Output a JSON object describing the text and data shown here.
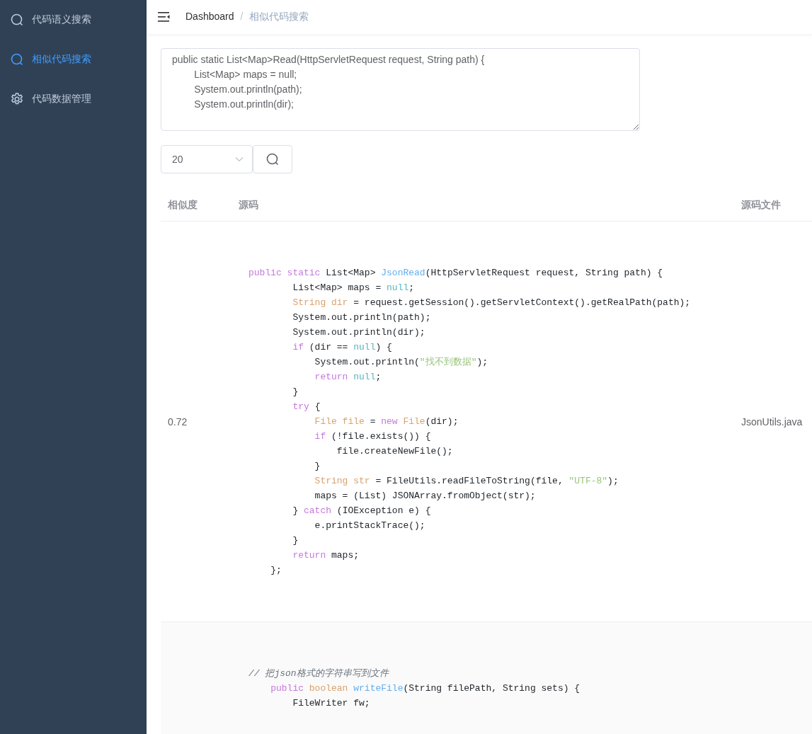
{
  "sidebar": {
    "items": [
      {
        "label": "代码语义搜索",
        "kind": "search",
        "selected": false
      },
      {
        "label": "相似代码搜索",
        "kind": "search",
        "selected": true
      },
      {
        "label": "代码数据管理",
        "kind": "settings",
        "selected": false
      }
    ]
  },
  "breadcrumb": [
    "Dashboard",
    "/",
    "相似代码搜索"
  ],
  "query": {
    "value": "public static List<Map>Read(HttpServletRequest request, String path) {\n\t\tList<Map> maps = null;\n\t\tSystem.out.println(path);\n\t\tSystem.out.println(dir);"
  },
  "count_select": {
    "value": "20"
  },
  "table": {
    "columns": [
      "相似度",
      "源码",
      "源码文件"
    ],
    "rows": [
      {
        "similarity": "0.72",
        "file": "JsonUtils.java",
        "code": [
          [
            {
              "kind": "keyword",
              "text": "public static"
            },
            {
              "kind": "plain",
              "text": " List<Map> "
            },
            {
              "kind": "function",
              "text": "JsonRead"
            },
            {
              "kind": "plain",
              "text": "(HttpServletRequest request, String path) {"
            }
          ],
          [
            {
              "kind": "plain",
              "text": "        List<Map> maps = "
            },
            {
              "kind": "literal",
              "text": "null"
            },
            {
              "kind": "plain",
              "text": ";"
            }
          ],
          [
            {
              "kind": "type",
              "text": "        String dir"
            },
            {
              "kind": "plain",
              "text": " = request.getSession().getServletContext().getRealPath(path);"
            }
          ],
          [
            {
              "kind": "plain",
              "text": "        System.out.println(path);"
            }
          ],
          [
            {
              "kind": "plain",
              "text": "        System.out.println(dir);"
            }
          ],
          [
            {
              "kind": "keyword",
              "text": "        if"
            },
            {
              "kind": "plain",
              "text": " (dir == "
            },
            {
              "kind": "literal",
              "text": "null"
            },
            {
              "kind": "plain",
              "text": ") {"
            }
          ],
          [
            {
              "kind": "plain",
              "text": "            System.out.println("
            },
            {
              "kind": "string",
              "text": "\"找不到数据\""
            },
            {
              "kind": "plain",
              "text": ");"
            }
          ],
          [
            {
              "kind": "keyword",
              "text": "            return"
            },
            {
              "kind": "literal",
              "text": " null"
            },
            {
              "kind": "plain",
              "text": ";"
            }
          ],
          [
            {
              "kind": "plain",
              "text": "        }"
            }
          ],
          [
            {
              "kind": "keyword",
              "text": "        try"
            },
            {
              "kind": "plain",
              "text": " {"
            }
          ],
          [
            {
              "kind": "type",
              "text": "            File file"
            },
            {
              "kind": "plain",
              "text": " = "
            },
            {
              "kind": "keyword",
              "text": "new"
            },
            {
              "kind": "type",
              "text": " File"
            },
            {
              "kind": "plain",
              "text": "(dir);"
            }
          ],
          [
            {
              "kind": "keyword",
              "text": "            if"
            },
            {
              "kind": "plain",
              "text": " (!file.exists()) {"
            }
          ],
          [
            {
              "kind": "plain",
              "text": "                file.createNewFile();"
            }
          ],
          [
            {
              "kind": "plain",
              "text": "            }"
            }
          ],
          [
            {
              "kind": "type",
              "text": "            String str"
            },
            {
              "kind": "plain",
              "text": " = FileUtils.readFileToString(file, "
            },
            {
              "kind": "string",
              "text": "\"UTF-8\""
            },
            {
              "kind": "plain",
              "text": ");"
            }
          ],
          [
            {
              "kind": "plain",
              "text": "            maps = (List) JSONArray.fromObject(str);"
            }
          ],
          [
            {
              "kind": "plain",
              "text": "        } "
            },
            {
              "kind": "keyword",
              "text": "catch"
            },
            {
              "kind": "plain",
              "text": " (IOException e) {"
            }
          ],
          [
            {
              "kind": "plain",
              "text": "            e.printStackTrace();"
            }
          ],
          [
            {
              "kind": "plain",
              "text": "        }"
            }
          ],
          [
            {
              "kind": "keyword",
              "text": "        return"
            },
            {
              "kind": "plain",
              "text": " maps;"
            }
          ],
          [
            {
              "kind": "plain",
              "text": "    };"
            }
          ]
        ]
      },
      {
        "code": [
          [
            {
              "kind": "comment",
              "text": "// 把json格式的字符串写到文件"
            }
          ],
          [
            {
              "kind": "keyword",
              "text": "    public"
            },
            {
              "kind": "type",
              "text": " boolean"
            },
            {
              "kind": "function",
              "text": " writeFile"
            },
            {
              "kind": "plain",
              "text": "(String filePath, String sets) {"
            }
          ],
          [
            {
              "kind": "plain",
              "text": "        FileWriter fw;"
            }
          ]
        ]
      }
    ]
  }
}
